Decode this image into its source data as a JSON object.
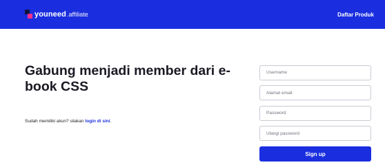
{
  "navbar": {
    "brand_name": "youneed",
    "brand_suffix": ".affiliate",
    "link_label": "Daftar Produk"
  },
  "hero": {
    "title": "Gabung menjadi member dari e-book CSS",
    "login_prompt": "Sudah memiliki akun? silakan ",
    "login_link": "login di sini",
    "login_end": "."
  },
  "form": {
    "username_placeholder": "Username",
    "email_placeholder": "Alamat email",
    "password_placeholder": "Password",
    "confirm_placeholder": "Ulangi password",
    "submit_label": "Sign up"
  },
  "colors": {
    "primary": "#1a2ee0",
    "logo_dark": "#0e1440",
    "logo_pink": "#ff2e8a"
  }
}
